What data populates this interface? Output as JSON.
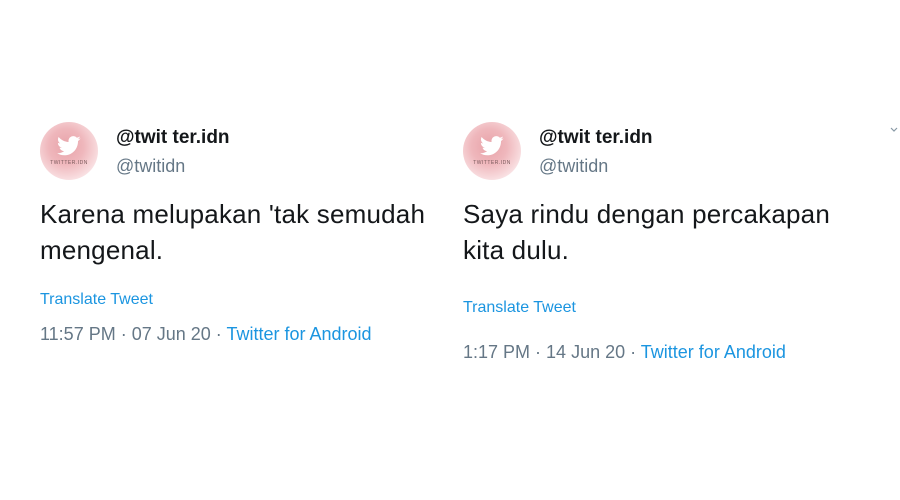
{
  "tweets": [
    {
      "avatar_text": "TWITTER.IDN",
      "display_name": "@twit ter.idn",
      "handle": "@twitidn",
      "text_line1": "Karena melupakan 'tak semudah",
      "text_line2": "mengenal.",
      "translate": "Translate Tweet",
      "time": "11:57 PM",
      "sep1": " · ",
      "date": "07 Jun 20",
      "sep2": " · ",
      "source": "Twitter for Android"
    },
    {
      "avatar_text": "TWITTER.IDN",
      "display_name": "@twit ter.idn",
      "handle": "@twitidn",
      "text_line1": "Saya rindu dengan percakapan",
      "text_line2": "kita dulu.",
      "translate": "Translate Tweet",
      "time": "1:17 PM",
      "sep1": " · ",
      "date": "14 Jun 20",
      "sep2": " · ",
      "source": "Twitter for Android"
    }
  ],
  "icons": {
    "avatar_bird": "twitter-bird-icon",
    "more": "chevron-down-icon"
  },
  "colors": {
    "link": "#1b95e0",
    "secondary": "#657786",
    "primary_text": "#14171a",
    "avatar_pink": "#e8a3a9"
  }
}
